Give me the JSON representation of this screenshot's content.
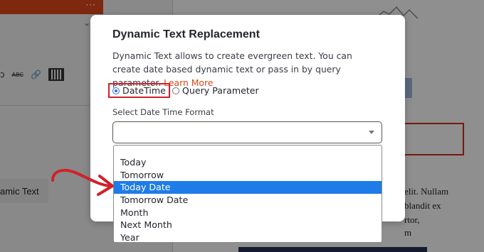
{
  "background": {
    "sidebar_item_label": "amic Text",
    "right_text_lines": [
      "elit. Nullam",
      "blandit ex",
      "rtor,",
      "m"
    ]
  },
  "modal": {
    "title": "Dynamic Text Replacement",
    "description": "Dynamic Text allows to create evergreen text. You can create date based dynamic text or pass in by query parameter.",
    "learn_more": "Learn More",
    "radio_options": [
      {
        "label": "DateTime",
        "checked": true
      },
      {
        "label": "Query Parameter",
        "checked": false
      }
    ],
    "select_label": "Select Date Time Format",
    "select_value": ""
  },
  "dropdown": {
    "items": [
      "Today",
      "Tomorrow",
      "Today Date",
      "Tomorrow Date",
      "Month",
      "Next Month",
      "Year"
    ],
    "highlighted": "Today Date"
  },
  "colors": {
    "accent": "#d9481a",
    "highlight_border": "#d1202a",
    "selected_row": "#1e7ce8",
    "radio_checked": "#2c6fe0"
  }
}
